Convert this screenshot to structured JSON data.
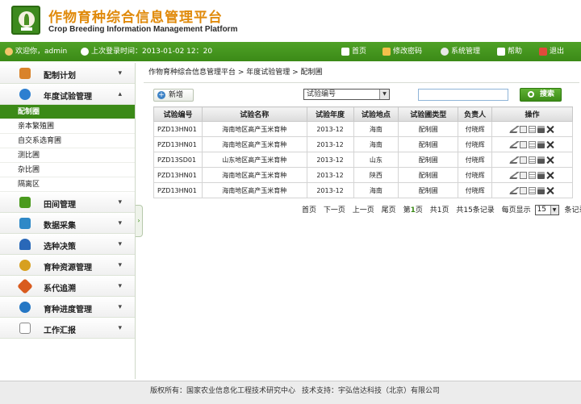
{
  "header": {
    "title_cn": "作物育种综合信息管理平台",
    "title_en": "Crop Breeding Information Management Platform"
  },
  "topbar": {
    "welcome": "欢迎你，admin",
    "last_login": "上次登录时间：2013-01-02 12：20",
    "home": "首页",
    "change_password": "修改密码",
    "system_admin": "系统管理",
    "help": "帮助",
    "logout": "退出"
  },
  "sidebar": {
    "sections": [
      {
        "label": "配制计划",
        "color": "#d9832b"
      },
      {
        "label": "年度试验管理",
        "color": "#2d7fd0"
      },
      {
        "label": "田间管理",
        "color": "#4a9a1e"
      },
      {
        "label": "数据采集",
        "color": "#2f89c7"
      },
      {
        "label": "选种决策",
        "color": "#2968b8"
      },
      {
        "label": "育种资源管理",
        "color": "#d7a020"
      },
      {
        "label": "系代追溯",
        "color": "#d95b1e"
      },
      {
        "label": "育种进度管理",
        "color": "#2577c4"
      },
      {
        "label": "工作汇报",
        "color": "#8a8a8a"
      }
    ],
    "sub_items": [
      "配制圈",
      "亲本繁殖圃",
      "自交系选育圃",
      "测比圃",
      "杂比圃",
      "隔离区"
    ]
  },
  "main": {
    "breadcrumb": "作物育种综合信息管理平台 > 年度试验管理 > 配制圃",
    "new_button": "新增",
    "filter_select": "试验编号",
    "search_button": "搜索",
    "columns": [
      "试验编号",
      "试验名称",
      "试验年度",
      "试验地点",
      "试验圃类型",
      "负责人",
      "操作"
    ],
    "rows": [
      [
        "PZD13HN01",
        "海南地区高产玉米育种",
        "2013-12",
        "海南",
        "配制圃",
        "付晓辉"
      ],
      [
        "PZD13HN01",
        "海南地区高产玉米育种",
        "2013-12",
        "海南",
        "配制圃",
        "付晓辉"
      ],
      [
        "PZD13SD01",
        "山东地区高产玉米育种",
        "2013-12",
        "山东",
        "配制圃",
        "付晓辉"
      ],
      [
        "PZD13HN01",
        "海南地区高产玉米育种",
        "2013-12",
        "陕西",
        "配制圃",
        "付晓辉"
      ],
      [
        "PZD13HN01",
        "海南地区高产玉米育种",
        "2013-12",
        "海南",
        "配制圃",
        "付晓辉"
      ]
    ],
    "pager": {
      "first": "首页",
      "next": "下一页",
      "prev": "上一页",
      "last": "尾页",
      "page_prefix": "第",
      "page_num": "1",
      "page_suffix": "页",
      "total_pages": "共1页",
      "total_records": "共15条记录",
      "per_page_label": "每页显示",
      "per_page_value": "15",
      "records_label": "条记录"
    }
  },
  "footer": {
    "copyright": "版权所有：国家农业信息化工程技术研究中心",
    "support": "技术支持：宇弘信达科技（北京）有限公司"
  }
}
